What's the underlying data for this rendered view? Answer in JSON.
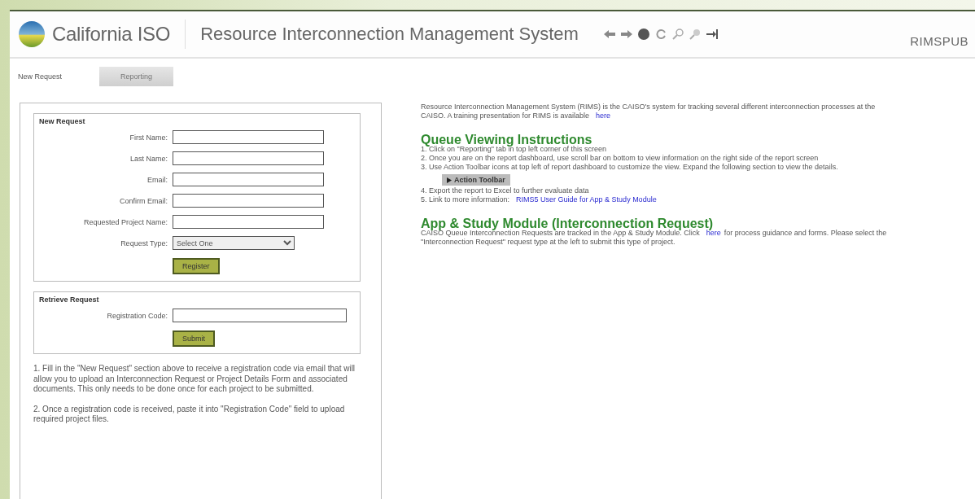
{
  "header": {
    "brand": "California ISO",
    "app_title": "Resource Interconnection Management System",
    "user": "RIMSPUB"
  },
  "tabs": [
    {
      "label": "New Request",
      "selected": true
    },
    {
      "label": "Reporting",
      "selected": false
    }
  ],
  "new_request": {
    "title": "New Request",
    "fields": [
      {
        "label": "First Name:",
        "kind": "text"
      },
      {
        "label": "Last Name:",
        "kind": "text"
      },
      {
        "label": "Email:",
        "kind": "text"
      },
      {
        "label": "Confirm Email:",
        "kind": "text"
      },
      {
        "label": "Requested Project Name:",
        "kind": "text"
      },
      {
        "label": "Request Type:",
        "kind": "select",
        "value": "Select One"
      }
    ],
    "button": "Register"
  },
  "retrieve_request": {
    "title": "Retrieve Request",
    "fields": [
      {
        "label": "Registration Code:",
        "kind": "text"
      }
    ],
    "button": "Submit"
  },
  "notes": [
    "1. Fill in the \"New Request\" section above to receive a registration code via email that will allow you to upload an Interconnection Request or Project Details Form and associated documents. This only needs to be done once for each project to be submitted.",
    "2. Once a registration code is received, paste it into \"Registration Code\" field to upload required project files."
  ],
  "intro": {
    "text": "Resource Interconnection Management System (RIMS) is the CAISO's system for tracking several different interconnection processes at the CAISO. A training presentation for RIMS is available",
    "link": "here"
  },
  "queue_section": {
    "heading": "Queue Viewing Instructions",
    "steps": [
      {
        "kind": "text",
        "text": "1. Click on \"Reporting\" tab in top left corner of this screen"
      },
      {
        "kind": "text",
        "text": "2. Once you are on the report dashboard, use scroll bar on bottom to view information on the right side of the report screen"
      },
      {
        "kind": "text",
        "text": "3. Use Action Toolbar icons at top left of report dashboard to customize the view. Expand the following section to view the details."
      },
      {
        "kind": "toggle",
        "text": "Action Toolbar",
        "expanded": false
      },
      {
        "kind": "text",
        "text": "4. Export the report to Excel to further evaluate data"
      },
      {
        "kind": "link",
        "text": "5. Link to more information:",
        "link": "RIMS5 User Guide for App & Study Module"
      }
    ]
  },
  "app_section": {
    "heading": "App & Study Module (Interconnection Request)",
    "text_before": "CAISO Queue Interconnection Requests are tracked in the App & Study Module. Click",
    "link": "here",
    "text_after": "for process guidance and forms. Please select the \"Interconnection Request\" request type at the left to submit this type of project."
  }
}
